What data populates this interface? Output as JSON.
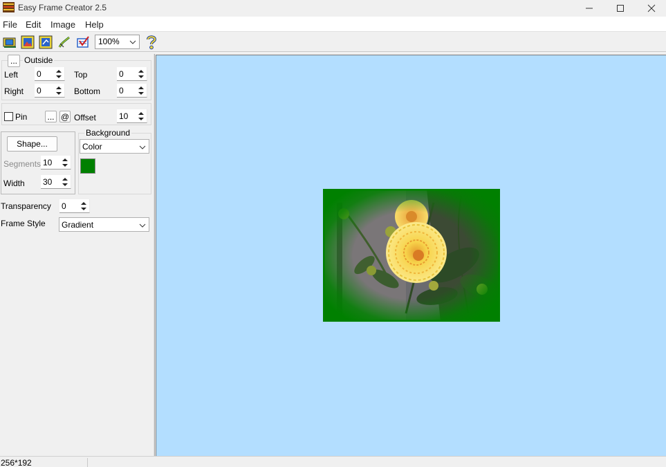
{
  "window": {
    "title": "Easy Frame Creator 2.5"
  },
  "menu": {
    "items": [
      "File",
      "Edit",
      "Image",
      "Help"
    ]
  },
  "toolbar": {
    "zoom_value": "100%",
    "icons": [
      "open-image-icon",
      "frame-image-icon",
      "save-image-icon",
      "draw-icon",
      "settings-check-icon",
      "help-icon"
    ]
  },
  "outside": {
    "label": "Outside",
    "button_label": "...",
    "left_label": "Left",
    "left_value": "0",
    "top_label": "Top",
    "top_value": "0",
    "right_label": "Right",
    "right_value": "0",
    "bottom_label": "Bottom",
    "bottom_value": "0"
  },
  "pin": {
    "label": "Pin",
    "checked": false,
    "dots_label": "...",
    "at_label": "@",
    "offset_label": "Offset",
    "offset_value": "10"
  },
  "shape": {
    "button_label": "Shape...",
    "segments_label": "Segments",
    "segments_value": "10",
    "width_label": "Width",
    "width_value": "30"
  },
  "background": {
    "label": "Background",
    "type_value": "Color",
    "color": "#008000"
  },
  "transparency": {
    "label": "Transparency",
    "value": "0"
  },
  "frame_style": {
    "label": "Frame Style",
    "value": "Gradient"
  },
  "canvas": {
    "background_color": "#b3deff",
    "frame_color": "#008000"
  },
  "status": {
    "image_size": "256*192"
  }
}
